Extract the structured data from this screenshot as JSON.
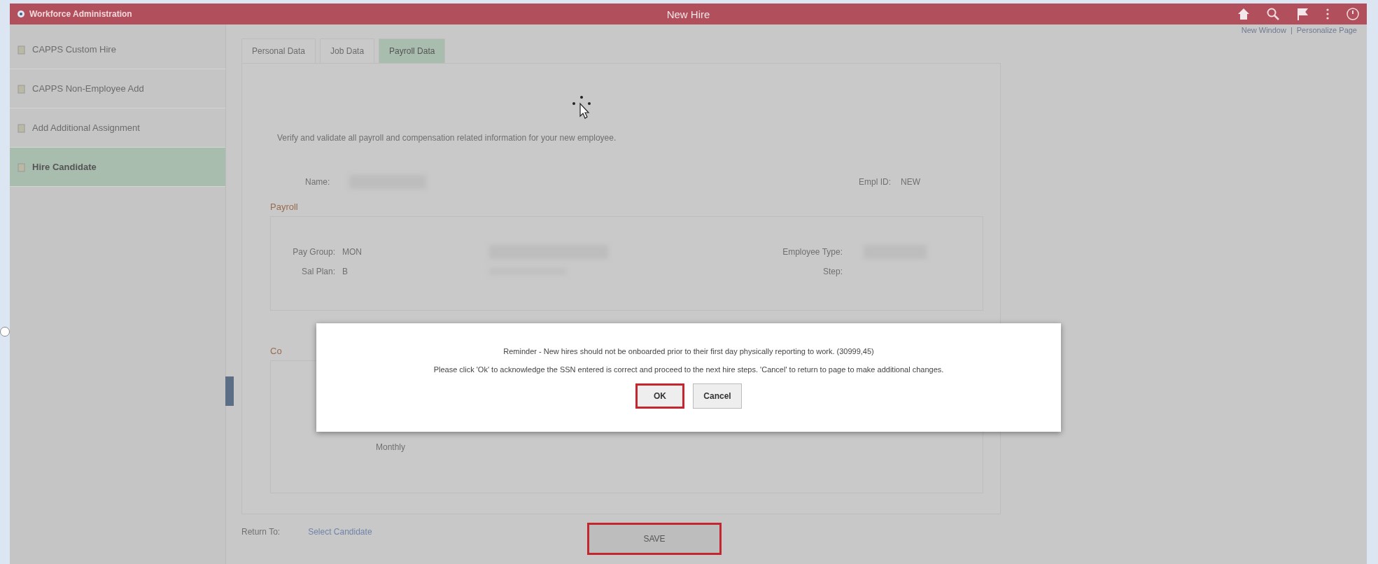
{
  "header": {
    "breadcrumb": "Workforce Administration",
    "title": "New Hire"
  },
  "sidebar": {
    "items": [
      {
        "label": "CAPPS Custom Hire",
        "selected": false
      },
      {
        "label": "CAPPS Non-Employee Add",
        "selected": false
      },
      {
        "label": "Add Additional Assignment",
        "selected": false
      },
      {
        "label": "Hire Candidate",
        "selected": true
      }
    ]
  },
  "top_links": [
    "New Window",
    "|",
    "Personalize Page"
  ],
  "tabs": [
    {
      "label": "Personal Data",
      "selected": false
    },
    {
      "label": "Job Data",
      "selected": false
    },
    {
      "label": "Payroll Data",
      "selected": true
    }
  ],
  "instruction": "Verify and validate all payroll and compensation related information for your new employee.",
  "name_row": {
    "name_label": "Name:",
    "empl_id_label": "Empl ID:",
    "empl_id": "NEW"
  },
  "payroll": {
    "title": "Payroll",
    "rows": [
      {
        "label": "Pay Group:",
        "value": "MON",
        "right_label": "Employee Type:"
      },
      {
        "label": "Sal Plan:",
        "value": "B",
        "right_label": "Step:"
      }
    ]
  },
  "compensation": {
    "title": "Co",
    "frequency": "Monthly"
  },
  "return_to": {
    "label": "Return To:",
    "link": "Select Candidate"
  },
  "save_button": {
    "label": "SAVE",
    "highlighted": true
  },
  "dialog": {
    "message": "Reminder - New hires should not be onboarded prior to their first day physically reporting to work. (30999,45)",
    "detail": "Please click 'Ok' to acknowledge the SSN entered is correct and proceed to the next hire steps. 'Cancel' to return to page to make additional changes.",
    "buttons": [
      {
        "label": "OK",
        "highlighted": true
      },
      {
        "label": "Cancel",
        "highlighted": false
      }
    ]
  }
}
